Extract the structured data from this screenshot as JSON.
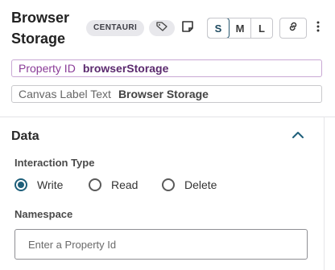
{
  "header": {
    "title": "Browser Storage",
    "badge": "CENTAURI",
    "tag_icon": "tag-icon",
    "note_icon": "note-icon",
    "sizes": [
      "S",
      "M",
      "L"
    ],
    "active_size": "S",
    "link_icon": "link-icon",
    "more_icon": "more-vertical-icon"
  },
  "property": {
    "label": "Property ID",
    "value": "browserStorage"
  },
  "canvas_label": {
    "label": "Canvas Label Text",
    "value": "Browser Storage"
  },
  "data_section": {
    "title": "Data",
    "chevron_icon": "chevron-up-icon",
    "interaction_label": "Interaction Type",
    "options": [
      {
        "label": "Write",
        "checked": true
      },
      {
        "label": "Read",
        "checked": false
      },
      {
        "label": "Delete",
        "checked": false
      }
    ],
    "namespace_label": "Namespace",
    "namespace_placeholder": "Enter a Property Id",
    "namespace_value": ""
  },
  "colors": {
    "accent": "#1e5f7a",
    "property_label": "#8a3b97",
    "property_value": "#5b2a6e"
  }
}
